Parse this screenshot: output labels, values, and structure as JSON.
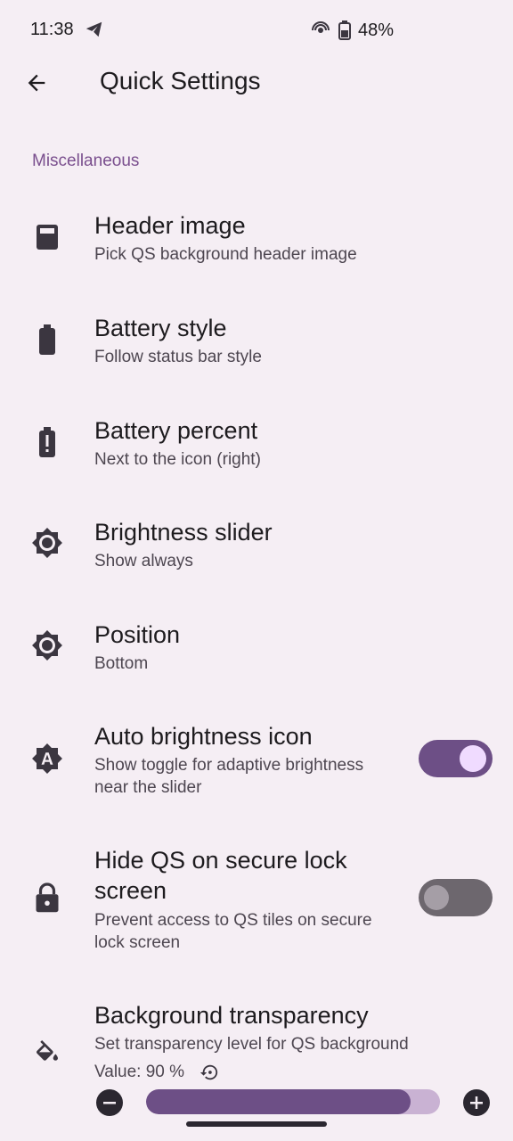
{
  "status_bar": {
    "time": "11:38",
    "battery_percent": "48%",
    "icons": [
      "telegram-icon",
      "hotspot-icon",
      "battery-icon"
    ]
  },
  "toolbar": {
    "back_icon": "arrow-back-icon",
    "title": "Quick Settings"
  },
  "section": {
    "title": "Miscellaneous"
  },
  "prefs": [
    {
      "icon": "image-icon",
      "title": "Header image",
      "summary": "Pick QS background header image"
    },
    {
      "icon": "battery-icon",
      "title": "Battery style",
      "summary": "Follow status bar style"
    },
    {
      "icon": "battery-alert-icon",
      "title": "Battery percent",
      "summary": "Next to the icon (right)"
    },
    {
      "icon": "brightness-icon",
      "title": "Brightness slider",
      "summary": "Show always"
    },
    {
      "icon": "brightness-icon",
      "title": "Position",
      "summary": "Bottom"
    },
    {
      "icon": "auto-brightness-icon",
      "title": "Auto brightness icon",
      "summary_line1": "Show toggle for adaptive brightness",
      "summary_line2": "near the slider",
      "toggle": true
    },
    {
      "icon": "lock-icon",
      "title_line1": "Hide QS on secure lock",
      "title_line2": "screen",
      "summary_line1": "Prevent access to QS tiles on secure",
      "summary_line2": "lock screen",
      "toggle": false
    },
    {
      "icon": "paint-bucket-icon",
      "title": "Background transparency",
      "summary": "Set transparency level for QS background",
      "value_text": "Value: 90 %",
      "slider_value": 0.9
    }
  ],
  "colors": {
    "background": "#f5eef4",
    "accent": "#6d4f86",
    "section_title": "#7a4f8e"
  }
}
